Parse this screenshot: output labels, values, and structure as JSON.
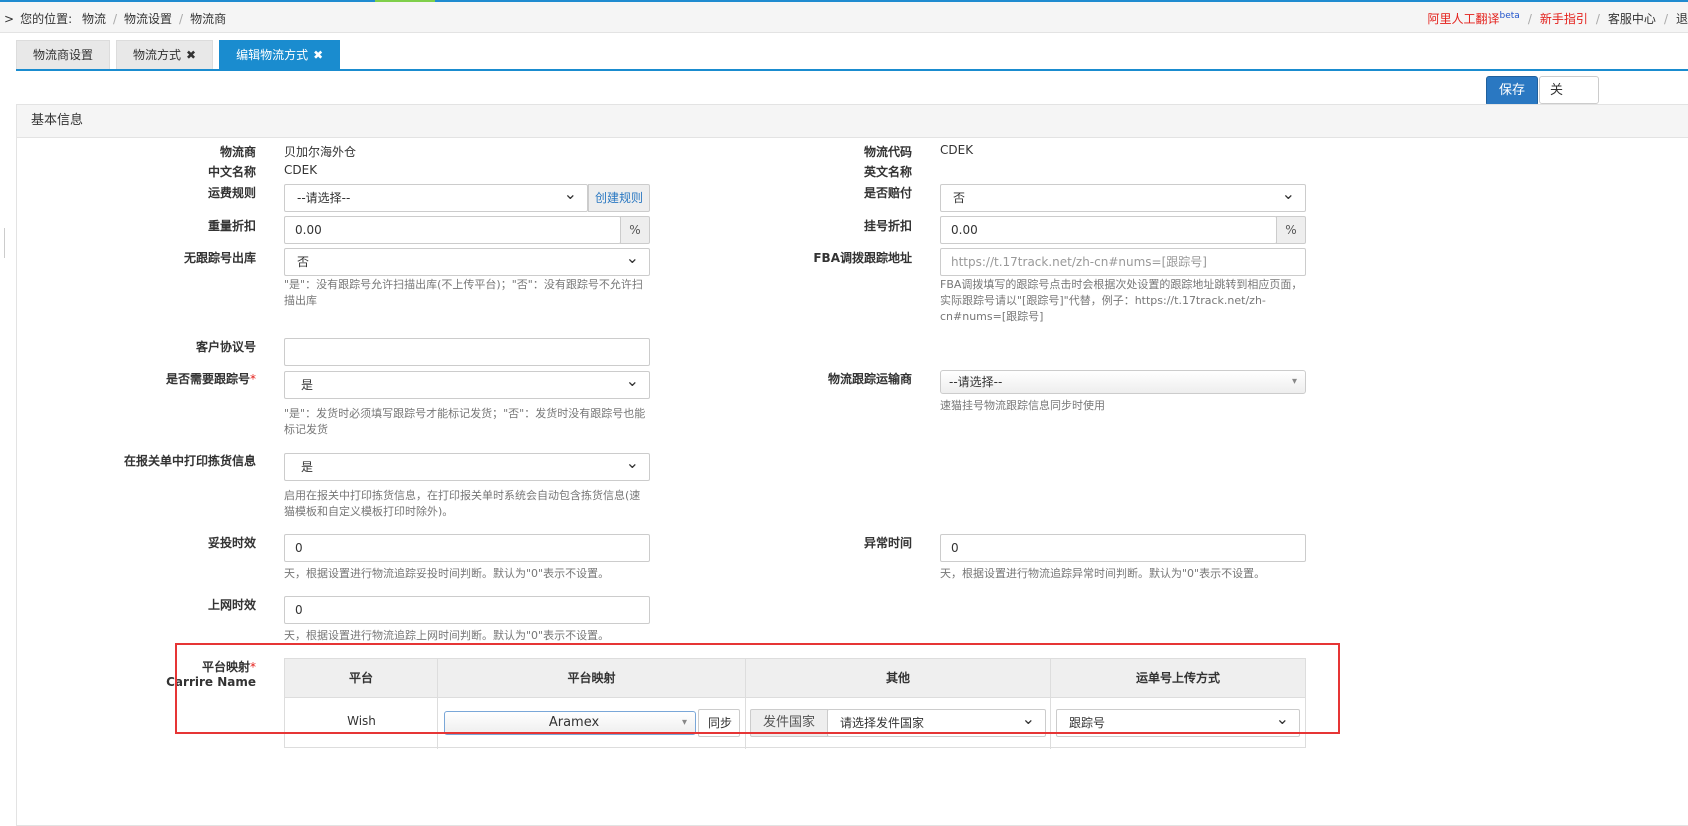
{
  "breadcrumb": {
    "prefix": "您的位置:",
    "items": [
      "物流",
      "物流设置",
      "物流商"
    ]
  },
  "toplinks": {
    "translate": "阿里人工翻译",
    "beta": "beta",
    "guide": "新手指引",
    "service": "客服中心",
    "logout": "退"
  },
  "tabs": [
    {
      "label": "物流商设置"
    },
    {
      "label": "物流方式",
      "close": "✖"
    },
    {
      "label": "编辑物流方式",
      "close": "✖"
    }
  ],
  "toolbar": {
    "save": "保存",
    "close": "关"
  },
  "panel": {
    "title": "基本信息"
  },
  "form": {
    "carrier": {
      "label": "物流商",
      "value": "贝加尔海外仓"
    },
    "code": {
      "label": "物流代码",
      "value": "CDEK"
    },
    "cn_name": {
      "label": "中文名称",
      "value": "CDEK"
    },
    "en_name": {
      "label": "英文名称",
      "value": ""
    },
    "freight_rule": {
      "label": "运费规则",
      "value": "--请选择--",
      "addon": "创建规则"
    },
    "compensate": {
      "label": "是否赔付",
      "value": "否"
    },
    "weight_discount": {
      "label": "重量折扣",
      "value": "0.00",
      "unit": "%"
    },
    "reg_discount": {
      "label": "挂号折扣",
      "value": "0.00",
      "unit": "%"
    },
    "no_track_out": {
      "label": "无跟踪号出库",
      "value": "否",
      "help": "\"是\"：没有跟踪号允许扫描出库(不上传平台)；\"否\"：没有跟踪号不允许扫描出库"
    },
    "fba_url": {
      "label": "FBA调拨跟踪地址",
      "placeholder": "https://t.17track.net/zh-cn#nums=[跟踪号]",
      "help": "FBA调拨填写的跟踪号点击时会根据次处设置的跟踪地址跳转到相应页面，实际跟踪号请以\"[跟踪号]\"代替，例子：https://t.17track.net/zh-cn#nums=[跟踪号]"
    },
    "customer_no": {
      "label": "客户协议号",
      "value": ""
    },
    "need_tracking": {
      "label": "是否需要跟踪号",
      "required": "*",
      "value": "是",
      "help": "\"是\"：发货时必须填写跟踪号才能标记发货；\"否\"：发货时没有跟踪号也能标记发货"
    },
    "track_carrier": {
      "label": "物流跟踪运输商",
      "value": "--请选择--",
      "help": "速猫挂号物流跟踪信息同步时使用"
    },
    "print_pick": {
      "label": "在报关单中打印拣货信息",
      "value": "是",
      "help": "启用在报关中打印拣货信息，在打印报关单时系统会自动包含拣货信息(速猫模板和自定义模板打印时除外)。"
    },
    "delivery_time": {
      "label": "妥投时效",
      "value": "0",
      "help": "天，根据设置进行物流追踪妥投时间判断。默认为\"0\"表示不设置。"
    },
    "abnormal_time": {
      "label": "异常时间",
      "value": "0",
      "help": "天，根据设置进行物流追踪异常时间判断。默认为\"0\"表示不设置。"
    },
    "online_time": {
      "label": "上网时效",
      "value": "0",
      "help": "天，根据设置进行物流追踪上网时间判断。默认为\"0\"表示不设置。"
    }
  },
  "mapping": {
    "label": "平台映射",
    "required": "*",
    "sublabel": "Carrire Name",
    "headers": [
      "平台",
      "平台映射",
      "其他",
      "运单号上传方式"
    ],
    "row": {
      "platform": "Wish",
      "mapping": "Aramex",
      "sync": "同步",
      "country_addon": "发件国家",
      "country": "请选择发件国家",
      "upload": "跟踪号"
    }
  }
}
